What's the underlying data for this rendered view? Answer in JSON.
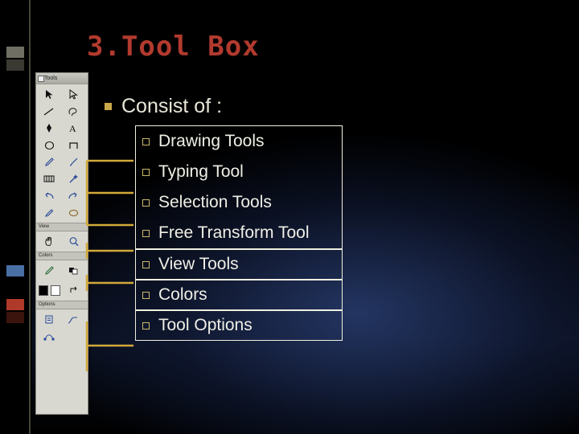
{
  "slide": {
    "title": "3.Tool Box",
    "lead": "Consist of :",
    "items": [
      "Drawing Tools",
      "Typing Tool",
      "Selection Tools",
      "Free Transform Tool",
      "View Tools",
      "Colors",
      "Tool Options"
    ]
  },
  "palette": {
    "window_title": "Tools",
    "section_view": "View",
    "section_colors": "Colors",
    "section_options": "Options",
    "tools": [
      "arrow-select-icon",
      "white-arrow-icon",
      "line-icon",
      "lasso-icon",
      "pen-icon",
      "text-a-icon",
      "ellipse-icon",
      "rectangle-icon",
      "pencil-icon",
      "brush-icon",
      "gradient-icon",
      "magic-wand-icon",
      "undo-arrow-icon",
      "redo-arrow-icon",
      "eyedropper-icon",
      "eraser-icon"
    ],
    "view_tools": [
      "hand-icon",
      "zoom-icon"
    ],
    "color_tools": [
      "color-pencil-icon",
      "color-swatch-icon"
    ],
    "swatches": [
      "#000000",
      "#ffffff"
    ],
    "option_tools": [
      "options-icon",
      "curve-icon",
      "node-icon"
    ]
  },
  "colors": {
    "title": "#b23a2e",
    "body_text": "#efefe6",
    "bullet_square": "#c8a84b",
    "bullet_hollow": "#cbb96a",
    "connector": "#d2a93a",
    "box_border": "#f0f0e0"
  }
}
